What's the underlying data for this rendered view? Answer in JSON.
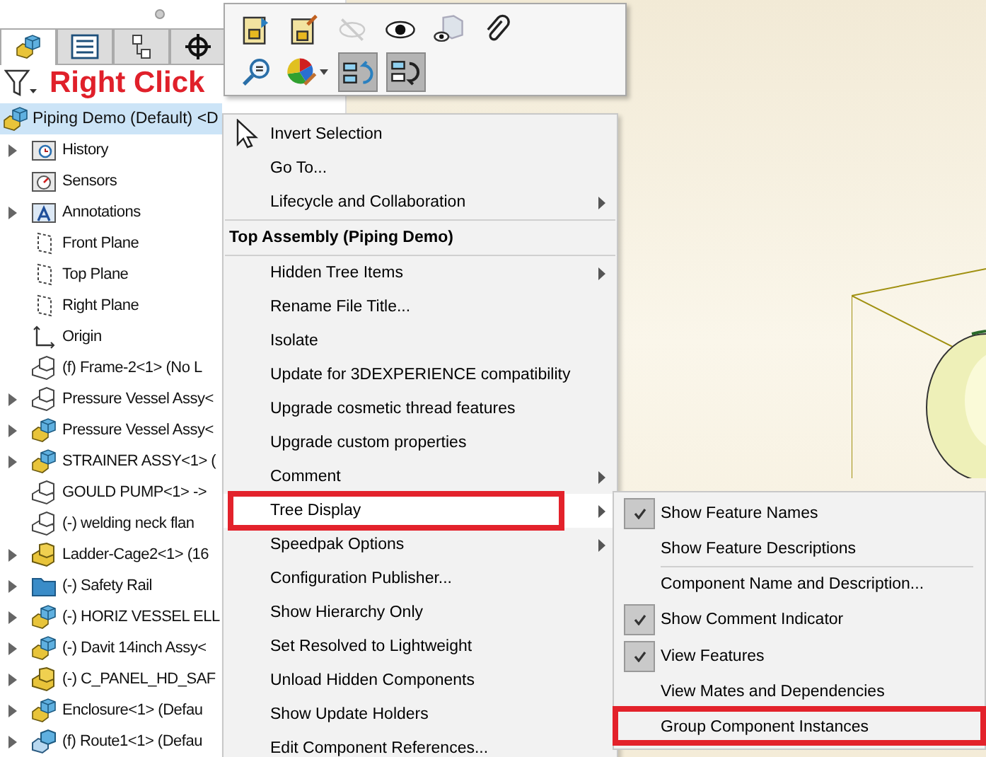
{
  "panel": {
    "annotation": "Right Click"
  },
  "tabs": [
    {
      "selected": true
    },
    {
      "selected": false
    },
    {
      "selected": false
    },
    {
      "selected": false
    }
  ],
  "toolbar": {
    "rows": [
      [
        {
          "pressed": false,
          "disabled": false
        },
        {
          "pressed": false,
          "disabled": false
        },
        {
          "pressed": false,
          "disabled": true
        },
        {
          "pressed": false,
          "disabled": false
        },
        {
          "pressed": false,
          "disabled": false
        },
        {
          "pressed": false,
          "disabled": false
        }
      ],
      [
        {
          "pressed": false,
          "disabled": false
        },
        {
          "pressed": false,
          "disabled": false
        },
        {
          "pressed": true,
          "disabled": false
        },
        {
          "pressed": true,
          "disabled": false
        }
      ]
    ]
  },
  "tree": {
    "root": {
      "label": "Piping Demo (Default) <D",
      "selected": true
    },
    "items": [
      {
        "label": "History",
        "kind": "history",
        "expandable": true
      },
      {
        "label": "Sensors",
        "kind": "sensor",
        "expandable": false
      },
      {
        "label": "Annotations",
        "kind": "annotation",
        "expandable": true
      },
      {
        "label": "Front Plane",
        "kind": "plane",
        "expandable": false
      },
      {
        "label": "Top Plane",
        "kind": "plane",
        "expandable": false
      },
      {
        "label": "Right Plane",
        "kind": "plane",
        "expandable": false
      },
      {
        "label": "Origin",
        "kind": "origin",
        "expandable": false
      },
      {
        "label": "(f) Frame-2<1> (No L",
        "kind": "part",
        "expandable": false
      },
      {
        "label": "Pressure Vessel Assy<",
        "kind": "part",
        "expandable": true
      },
      {
        "label": "Pressure Vessel Assy<",
        "kind": "assembly",
        "expandable": true
      },
      {
        "label": "STRAINER ASSY<1> (",
        "kind": "assembly",
        "expandable": true
      },
      {
        "label": "GOULD PUMP<1> ->",
        "kind": "part",
        "expandable": false
      },
      {
        "label": "(-) welding neck flan",
        "kind": "part",
        "expandable": false
      },
      {
        "label": "Ladder-Cage2<1> (16",
        "kind": "block",
        "expandable": true
      },
      {
        "label": "(-) Safety Rail",
        "kind": "folder",
        "expandable": true
      },
      {
        "label": "(-) HORIZ VESSEL ELL",
        "kind": "assembly",
        "expandable": true
      },
      {
        "label": "(-) Davit 14inch Assy<",
        "kind": "assembly",
        "expandable": true
      },
      {
        "label": "(-) C_PANEL_HD_SAF",
        "kind": "block",
        "expandable": true
      },
      {
        "label": "Enclosure<1> (Defau",
        "kind": "assembly",
        "expandable": true
      },
      {
        "label": "(f) Route1<1> (Defau",
        "kind": "route",
        "expandable": true
      }
    ]
  },
  "context_menu": {
    "items": [
      {
        "kind": "pointer",
        "label": "Invert Selection",
        "submenu": false,
        "highlighted": false,
        "marked": false
      },
      {
        "kind": "item",
        "label": "Go To...",
        "submenu": false,
        "highlighted": false,
        "marked": false
      },
      {
        "kind": "item",
        "label": "Lifecycle and Collaboration",
        "submenu": true,
        "highlighted": false,
        "marked": false
      },
      {
        "kind": "separator"
      },
      {
        "kind": "header",
        "label": "Top Assembly (Piping Demo)"
      },
      {
        "kind": "separator"
      },
      {
        "kind": "item",
        "label": "Hidden Tree Items",
        "submenu": true,
        "highlighted": false,
        "marked": false
      },
      {
        "kind": "item",
        "label": "Rename File Title...",
        "submenu": false,
        "highlighted": false,
        "marked": false
      },
      {
        "kind": "item",
        "label": "Isolate",
        "submenu": false,
        "highlighted": false,
        "marked": false
      },
      {
        "kind": "item",
        "label": "Update for 3DEXPERIENCE compatibility",
        "submenu": false,
        "highlighted": false,
        "marked": false
      },
      {
        "kind": "item",
        "label": "Upgrade cosmetic thread features",
        "submenu": false,
        "highlighted": false,
        "marked": false
      },
      {
        "kind": "item",
        "label": "Upgrade custom properties",
        "submenu": false,
        "highlighted": false,
        "marked": false
      },
      {
        "kind": "item",
        "label": "Comment",
        "submenu": true,
        "highlighted": false,
        "marked": false
      },
      {
        "kind": "item",
        "label": "Tree Display",
        "submenu": true,
        "highlighted": true,
        "marked": true
      },
      {
        "kind": "item",
        "label": "Speedpak Options",
        "submenu": true,
        "highlighted": false,
        "marked": false
      },
      {
        "kind": "item",
        "label": "Configuration Publisher...",
        "submenu": false,
        "highlighted": false,
        "marked": false
      },
      {
        "kind": "item",
        "label": "Show Hierarchy Only",
        "submenu": false,
        "highlighted": false,
        "marked": false
      },
      {
        "kind": "item",
        "label": "Set Resolved to Lightweight",
        "submenu": false,
        "highlighted": false,
        "marked": false
      },
      {
        "kind": "item",
        "label": "Unload Hidden Components",
        "submenu": false,
        "highlighted": false,
        "marked": false
      },
      {
        "kind": "item",
        "label": "Show Update Holders",
        "submenu": false,
        "highlighted": false,
        "marked": false
      },
      {
        "kind": "item",
        "label": "Edit Component References...",
        "submenu": false,
        "highlighted": false,
        "marked": false
      }
    ]
  },
  "submenu": {
    "items": [
      {
        "kind": "item",
        "label": "Show Feature Names",
        "checked": true,
        "marked": false
      },
      {
        "kind": "item",
        "label": "Show Feature Descriptions",
        "checked": false,
        "marked": false
      },
      {
        "kind": "separator"
      },
      {
        "kind": "item",
        "label": "Component Name and Description...",
        "checked": false,
        "marked": false
      },
      {
        "kind": "item",
        "label": "Show Comment Indicator",
        "checked": true,
        "marked": false
      },
      {
        "kind": "item",
        "label": "View Features",
        "checked": true,
        "marked": false
      },
      {
        "kind": "item",
        "label": "View Mates and Dependencies",
        "checked": false,
        "marked": false
      },
      {
        "kind": "item",
        "label": "Group Component Instances",
        "checked": false,
        "marked": true
      }
    ]
  }
}
